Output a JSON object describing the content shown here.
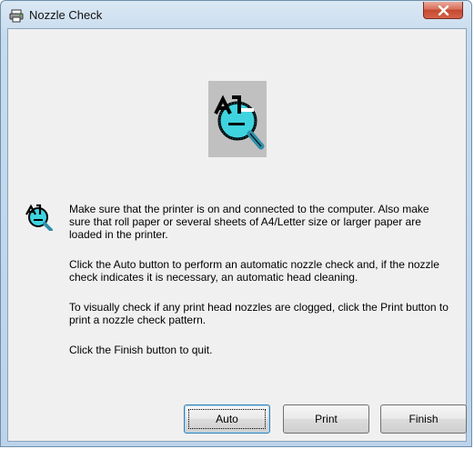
{
  "window": {
    "title": "Nozzle Check",
    "title_icon": "printer-icon",
    "close_icon": "close-icon"
  },
  "main": {
    "hero_icon": "nozzle-check-magnifier-icon",
    "info_icon": "nozzle-check-info-icon",
    "paragraphs": [
      "Make sure that the printer is on and connected to the computer. Also make sure that roll paper or several sheets of A4/Letter size or larger paper are loaded in the printer.",
      "Click the Auto button to perform an automatic nozzle check and, if the nozzle check indicates it is necessary, an automatic head cleaning.",
      "To visually check if any print head nozzles are clogged, click the Print button to print a nozzle check pattern.",
      "Click the Finish button to quit."
    ]
  },
  "buttons": {
    "auto": "Auto",
    "print": "Print",
    "finish": "Finish"
  },
  "colors": {
    "close_button": "#c34a30",
    "client_background": "#f0f0f0",
    "hero_background": "#c0c0c0",
    "lens_fill": "#3fd3e0",
    "handle": "#2f8fa8"
  }
}
